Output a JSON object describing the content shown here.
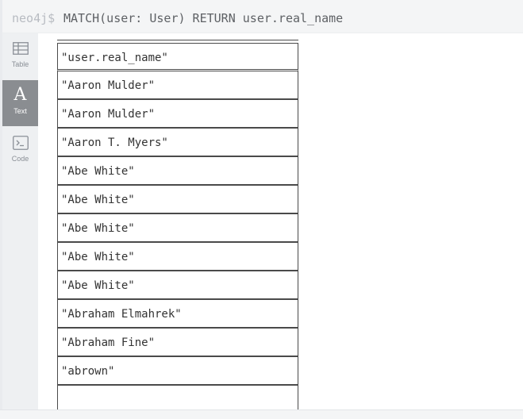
{
  "query": {
    "prompt": "neo4j$",
    "command": "MATCH(user: User) RETURN user.real_name"
  },
  "sidebar": {
    "items": [
      {
        "label": "Table",
        "icon": "table-icon",
        "active": false
      },
      {
        "label": "Text",
        "icon": "text-icon",
        "active": true
      },
      {
        "label": "Code",
        "icon": "code-icon",
        "active": false
      }
    ]
  },
  "table": {
    "header": "\"user.real_name\"",
    "rows": [
      "\"Aaron Mulder\"",
      "\"Aaron Mulder\"",
      "\"Aaron T. Myers\"",
      "\"Abe White\"",
      "\"Abe White\"",
      "\"Abe White\"",
      "\"Abe White\"",
      "\"Abe White\"",
      "\"Abraham Elmahrek\"",
      "\"Abraham Fine\"",
      "\"abrown\""
    ]
  }
}
